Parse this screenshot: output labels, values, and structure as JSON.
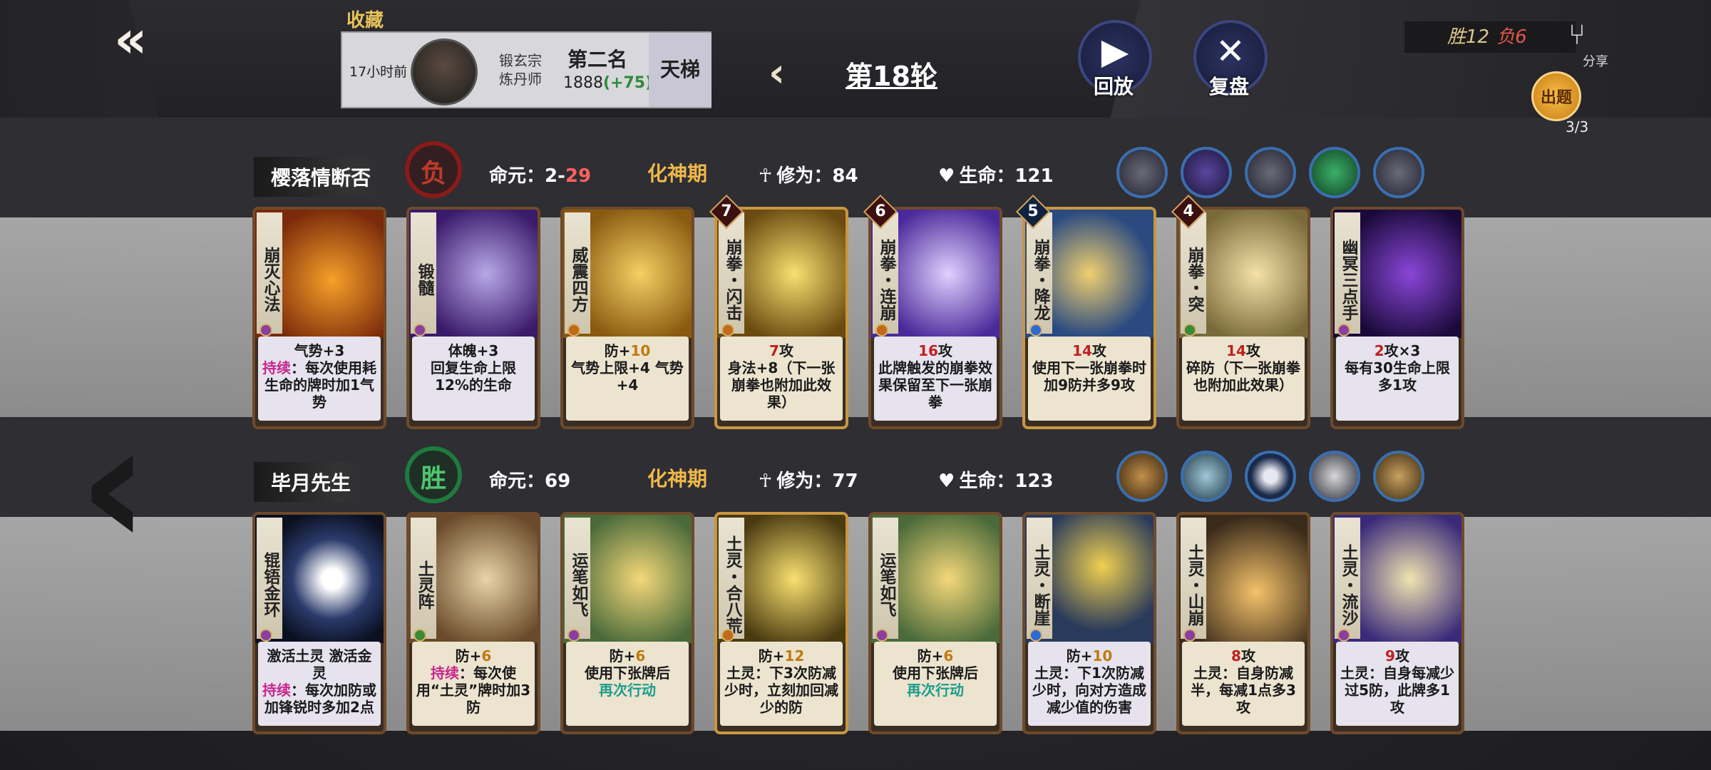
{
  "header": {
    "back_icon": "double-arrow-left-icon",
    "fav_label": "收藏",
    "opponent": {
      "time_ago": "17小时前",
      "sect_line1": "锻玄宗",
      "sect_line2": "炼丹师",
      "rank": "第二名",
      "score": "1888",
      "score_delta": "(+75)"
    },
    "ladder_label": "天梯",
    "round_label": "第18轮",
    "replay_label": "回放",
    "review_label": "复盘",
    "record_win": "胜12",
    "record_loss": "负6",
    "share_label": "分享",
    "quest_label": "出题",
    "quest_count": "3/3"
  },
  "player1": {
    "name": "樱落情断否",
    "result": "负",
    "life_label": "命元：",
    "life_value": "2-",
    "life_loss": "29",
    "realm": "化神期",
    "cultivation_label": "修为：84",
    "hp_label": "生命：121",
    "cards": [
      {
        "title": "崩灭心法",
        "line1": "气势+3",
        "kw": "持续",
        "rest": "：每次使用耗生命的牌时加1气势"
      },
      {
        "title": "锻髓",
        "line1": "体魄+3",
        "rest": "回复生命上限12%的生命"
      },
      {
        "title": "威震四方",
        "pre": "防+",
        "num": "10",
        "rest": "气势上限+4 气势+4"
      },
      {
        "title": "崩拳・闪击",
        "badge": "7",
        "num": "7",
        "post": "攻",
        "rest": "身法+8（下一张崩拳也附加此效果）"
      },
      {
        "title": "崩拳・连崩",
        "badge": "6",
        "num": "16",
        "post": "攻",
        "rest": "此牌触发的崩拳效果保留至下一张崩拳"
      },
      {
        "title": "崩拳・降龙",
        "badge": "5",
        "num": "14",
        "post": "攻",
        "rest": "使用下一张崩拳时加9防并多9攻"
      },
      {
        "title": "崩拳・突",
        "badge": "4",
        "num": "14",
        "post": "攻",
        "rest": "碎防（下一张崩拳也附加此效果）"
      },
      {
        "title": "幽冥三点手",
        "num": "2",
        "post": "攻×3",
        "rest": "每有30生命上限多1攻"
      }
    ]
  },
  "player2": {
    "name": "毕月先生",
    "result": "胜",
    "life_label": "命元：",
    "life_value": "69",
    "realm": "化神期",
    "cultivation_label": "修为：77",
    "hp_label": "生命：123",
    "cards": [
      {
        "title": "锟铻金环",
        "line1": "激活土灵 激活金灵",
        "kw": "持续",
        "rest": "：每次加防或加锋锐时多加2点"
      },
      {
        "title": "土灵阵",
        "pre": "防+",
        "num": "6",
        "kw": "持续",
        "rest": "：每次使用“土灵”牌时加3防"
      },
      {
        "title": "运笔如飞",
        "pre": "防+",
        "num": "6",
        "rest": "使用下张牌后",
        "again": "再次行动"
      },
      {
        "title": "土灵・合八荒",
        "pre": "防+",
        "num": "12",
        "rest": "土灵：下3次防减少时，立刻加回减少的防"
      },
      {
        "title": "运笔如飞",
        "pre": "防+",
        "num": "6",
        "rest": "使用下张牌后",
        "again": "再次行动"
      },
      {
        "title": "土灵・断崖",
        "pre": "防+",
        "num": "10",
        "rest": "土灵：下1次防减少时，向对方造成减少值的伤害"
      },
      {
        "title": "土灵・山崩",
        "num": "8",
        "post": "攻",
        "rest": "土灵：自身防减半，每减1点多3攻"
      },
      {
        "title": "土灵・流沙",
        "num": "9",
        "post": "攻",
        "rest": "土灵：自身每减少过5防，此牌多1攻"
      }
    ]
  }
}
